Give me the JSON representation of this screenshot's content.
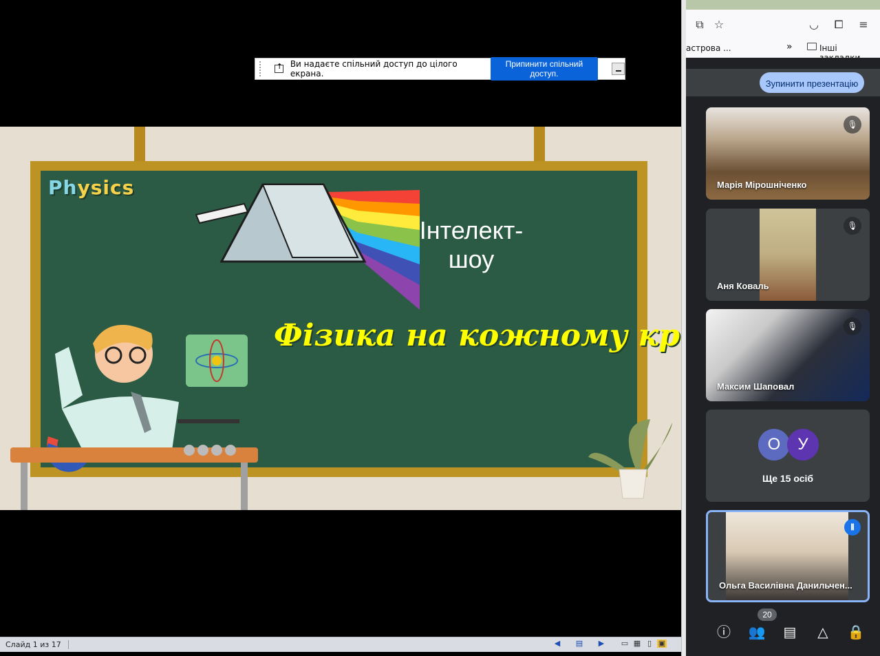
{
  "share_bar": {
    "message": "Ви надаєте спільний доступ до цілого екрана.",
    "stop_label": "Припинити спільний доступ."
  },
  "slide": {
    "logo_first": "Ph",
    "logo_rest": "ysics",
    "title_line1": "Інтелект-",
    "title_line2": "шоу",
    "subtitle": "Фізика на кожному кроці"
  },
  "status_bar": {
    "slide_counter": "Слайд 1 из 17"
  },
  "browser": {
    "bookmark_partial": "астрова ...",
    "other_bookmarks": "Інші закладки"
  },
  "meet": {
    "stop_presenting": "Зупинити презентацію",
    "participants": [
      {
        "name": "Марія Мірошніченко",
        "muted": true
      },
      {
        "name": "Аня Коваль",
        "muted": true
      },
      {
        "name": "Максим Шаповал",
        "muted": true
      }
    ],
    "others": {
      "avatars": [
        {
          "letter": "О",
          "color": "#5c6bc0"
        },
        {
          "letter": "У",
          "color": "#5e35b1"
        }
      ],
      "label": "Ще 15 осіб"
    },
    "speaker": {
      "name": "Ольга Василівна Данильчен..."
    },
    "people_count": "20"
  }
}
